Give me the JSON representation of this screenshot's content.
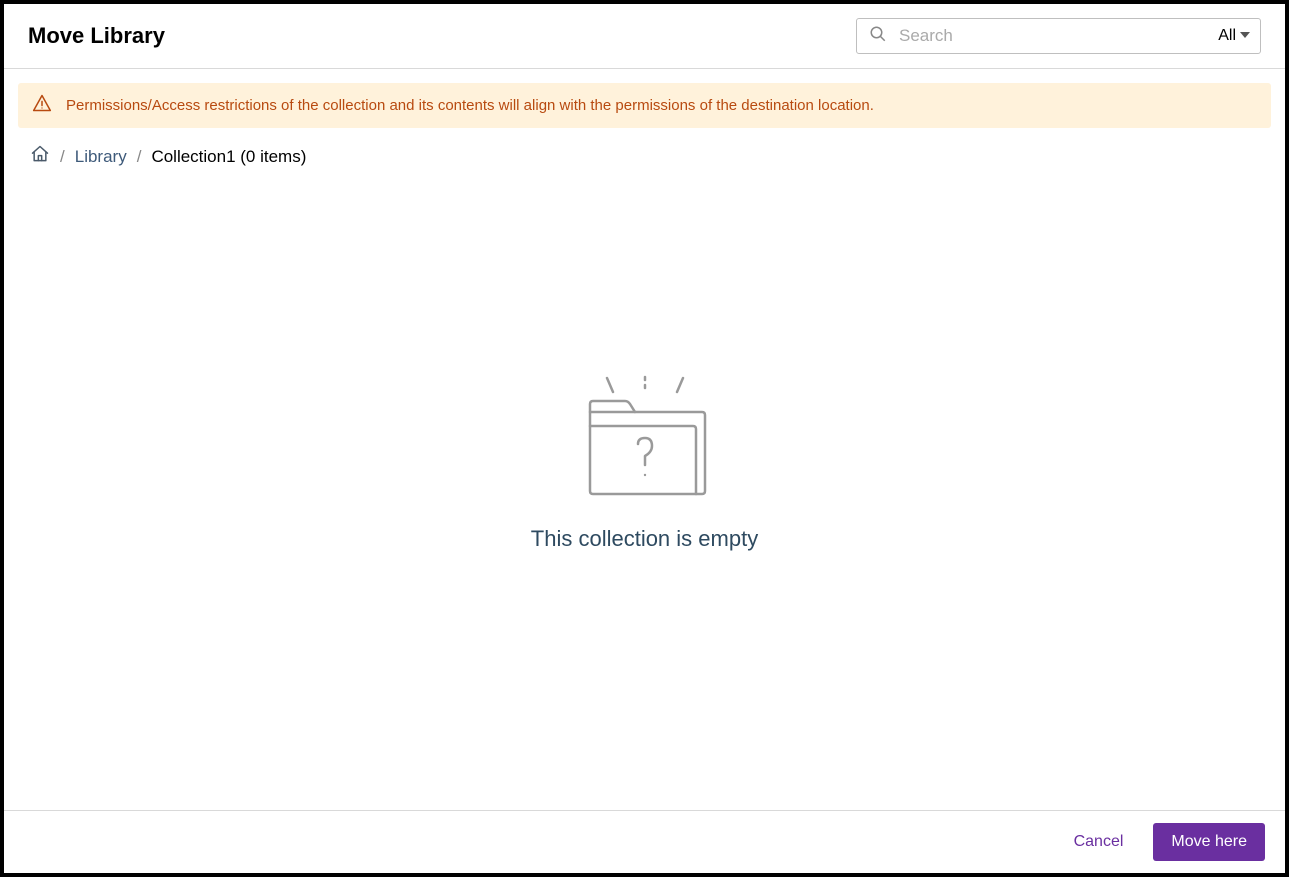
{
  "header": {
    "title": "Move Library",
    "search_placeholder": "Search",
    "filter_label": "All"
  },
  "banner": {
    "text": "Permissions/Access restrictions of the collection and its contents will align with the permissions of the destination location."
  },
  "breadcrumb": {
    "separator": "/",
    "library_label": "Library",
    "current": "Collection1 (0 items)"
  },
  "empty": {
    "message": "This collection is empty"
  },
  "footer": {
    "cancel_label": "Cancel",
    "move_label": "Move here"
  }
}
